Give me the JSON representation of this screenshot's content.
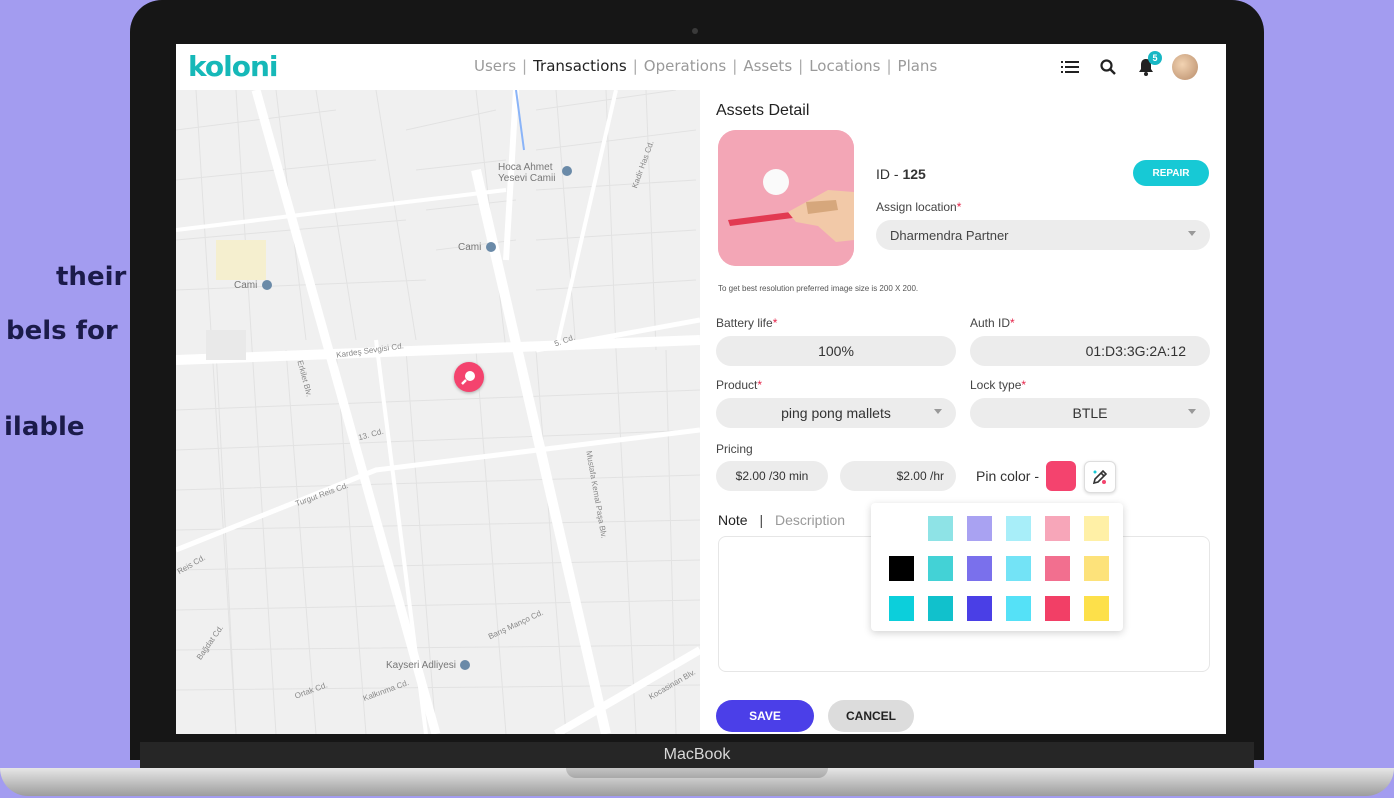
{
  "background_text": [
    "their",
    "bels for",
    "ilable"
  ],
  "device_label": "MacBook",
  "app": {
    "logo": "koloni",
    "nav": [
      "Users",
      "Transactions",
      "Operations",
      "Assets",
      "Locations",
      "Plans"
    ],
    "active_nav": "Transactions",
    "notification_count": "5",
    "icons": [
      "list-icon",
      "search-icon",
      "bell-icon",
      "avatar"
    ]
  },
  "map": {
    "labels": [
      "Hoca Ahmet Yesevi Camii",
      "Cami",
      "Cami",
      "Kardeş Sevgisi Cd.",
      "5. Cd.",
      "Kadir Has Cd.",
      "13. Cd.",
      "Turgut Reis Cd.",
      "Mustafa Kemal Paşa Blv.",
      "Barış Manço Cd.",
      "Kayseri Adliyesi",
      "Kalkınma Cd.",
      "Ortak Cd.",
      "Erkilet Blv.",
      "Kocasinan Blv.",
      "Bağdat Cd.",
      "Reis Cd."
    ],
    "pin_color": "#f4436e",
    "vehicle_filters": [
      {
        "icon": "scooter-icon",
        "color": "#5b50e8"
      },
      {
        "icon": "bicycle-icon",
        "color": "#1fc2d6"
      },
      {
        "icon": "ping-pong-icon",
        "color": "#f4436e"
      },
      {
        "icon": "misc-icon",
        "color": "#f2d03b"
      }
    ]
  },
  "detail": {
    "title": "Assets Detail",
    "id_label": "ID - ",
    "id_value": "125",
    "repair_label": "REPAIR",
    "assign_location_label": "Assign location",
    "assign_location_value": "Dharmendra Partner",
    "image_hint": "To get best resolution preferred image size is 200 X 200.",
    "battery_label": "Battery life",
    "battery_value": "100%",
    "auth_label": "Auth ID",
    "auth_value": "01:D3:3G:2A:12",
    "product_label": "Product",
    "product_value": "ping pong mallets",
    "lock_label": "Lock type",
    "lock_value": "BTLE",
    "pricing_label": "Pricing",
    "price_per_30": "$2.00 /30 min",
    "price_per_hr": "$2.00 /hr",
    "pin_color_label": "Pin color -",
    "pin_color_value": "#f4436e",
    "tabs": [
      "Note",
      "Description"
    ],
    "save_label": "SAVE",
    "cancel_label": "CANCEL"
  },
  "palette": [
    [
      null,
      "#8ee3e6",
      "#a9a2f2",
      "#a8eef9",
      "#f7a6b9",
      "#fff0a6"
    ],
    [
      "#000000",
      "#43d2d6",
      "#7a70ec",
      "#73e3f6",
      "#f26f8f",
      "#fde27a"
    ],
    [
      "#0ccfdb",
      "#11c1cc",
      "#4a3fe6",
      "#55e1f7",
      "#f23f66",
      "#fde04a"
    ]
  ]
}
